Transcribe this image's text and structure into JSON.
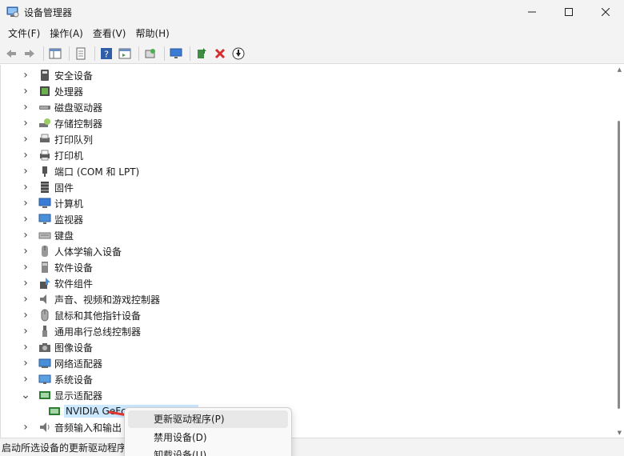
{
  "window": {
    "title": "设备管理器"
  },
  "menu": [
    "文件(F)",
    "操作(A)",
    "查看(V)",
    "帮助(H)"
  ],
  "tree": [
    {
      "label": "安全设备",
      "icon": "security-device-icon",
      "expanded": false
    },
    {
      "label": "处理器",
      "icon": "processor-icon",
      "expanded": false
    },
    {
      "label": "磁盘驱动器",
      "icon": "disk-drive-icon",
      "expanded": false
    },
    {
      "label": "存储控制器",
      "icon": "storage-controller-icon",
      "expanded": false
    },
    {
      "label": "打印队列",
      "icon": "print-queue-icon",
      "expanded": false
    },
    {
      "label": "打印机",
      "icon": "printer-icon",
      "expanded": false
    },
    {
      "label": "端口 (COM 和 LPT)",
      "icon": "port-icon",
      "expanded": false
    },
    {
      "label": "固件",
      "icon": "firmware-icon",
      "expanded": false
    },
    {
      "label": "计算机",
      "icon": "computer-icon",
      "expanded": false
    },
    {
      "label": "监视器",
      "icon": "monitor-icon",
      "expanded": false
    },
    {
      "label": "键盘",
      "icon": "keyboard-icon",
      "expanded": false
    },
    {
      "label": "人体学输入设备",
      "icon": "hid-icon",
      "expanded": false
    },
    {
      "label": "软件设备",
      "icon": "software-device-icon",
      "expanded": false
    },
    {
      "label": "软件组件",
      "icon": "software-component-icon",
      "expanded": false
    },
    {
      "label": "声音、视频和游戏控制器",
      "icon": "sound-icon",
      "expanded": false
    },
    {
      "label": "鼠标和其他指针设备",
      "icon": "mouse-icon",
      "expanded": false
    },
    {
      "label": "通用串行总线控制器",
      "icon": "usb-icon",
      "expanded": false
    },
    {
      "label": "图像设备",
      "icon": "camera-icon",
      "expanded": false
    },
    {
      "label": "网络适配器",
      "icon": "network-adapter-icon",
      "expanded": false
    },
    {
      "label": "系统设备",
      "icon": "system-device-icon",
      "expanded": false
    },
    {
      "label": "显示适配器",
      "icon": "display-adapter-icon",
      "expanded": true
    },
    {
      "label": "NVIDIA GeFc",
      "icon": "display-adapter-icon",
      "child": true,
      "selected": true
    },
    {
      "label": "音频输入和输出",
      "icon": "audio-io-icon",
      "expanded": false
    }
  ],
  "context_menu": [
    "更新驱动程序(P)",
    "禁用设备(D)",
    "卸载设备(U)"
  ],
  "status": "启动所选设备的更新驱动程序",
  "colors": {
    "selection": "#cce8ff",
    "arrow": "#e53935",
    "delete": "#d32f2f"
  }
}
